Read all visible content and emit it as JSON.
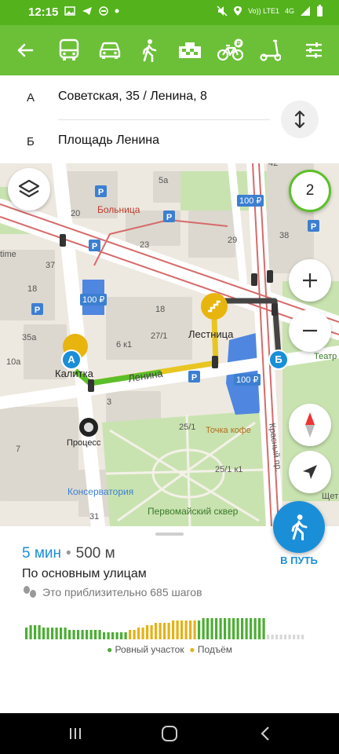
{
  "status_bar": {
    "time": "12:15",
    "network_label": "Vo)) LTE1",
    "network_type": "4G"
  },
  "toolbar": {
    "modes": [
      "back",
      "bus",
      "car",
      "walk",
      "taxi",
      "bike",
      "scooter",
      "settings"
    ]
  },
  "route": {
    "from_letter": "А",
    "from_address": "Советская, 35 / Ленина, 8",
    "to_letter": "Б",
    "to_address": "Площадь Ленина"
  },
  "map": {
    "layers_count": "2",
    "labels": {
      "hospital": "Больница",
      "lenina_street": "Ленина",
      "stairs": "Лестница",
      "kalitka": "Калитка",
      "process": "Процесс",
      "conservatory": "Консерватория",
      "square": "Первомайский сквер",
      "coffee": "Точка кофе",
      "theatre": "Театр",
      "krasny": "Красный пр.",
      "schet": "Щет",
      "time": "time"
    },
    "parking_price": "100 ₽",
    "house_numbers": [
      "5а",
      "20",
      "23",
      "29",
      "37",
      "18",
      "18",
      "35а",
      "10а",
      "27/1",
      "6 к1",
      "3",
      "25/1",
      "25/1 к1",
      "7",
      "31",
      "38",
      "42"
    ],
    "marker_a": "А",
    "marker_b": "Б"
  },
  "summary": {
    "time": "5 мин",
    "distance": "500 м",
    "subtitle": "По основным улицам",
    "steps": "Это приблизительно 685 шагов",
    "legend_flat": "Ровный участок",
    "legend_climb": "Подъём"
  },
  "elevation": {
    "bars": [
      5,
      6,
      6,
      6,
      5,
      5,
      5,
      5,
      5,
      5,
      4,
      4,
      4,
      4,
      4,
      4,
      4,
      4,
      3,
      3,
      3,
      3,
      3,
      3,
      4,
      4,
      5,
      5,
      6,
      6,
      7,
      7,
      7,
      7,
      8,
      8,
      8,
      8,
      8,
      8,
      8,
      9,
      9,
      9,
      9,
      9,
      9,
      9,
      9,
      9,
      9,
      9,
      9,
      9,
      9,
      9,
      2,
      2,
      2,
      2,
      2,
      2,
      2,
      2,
      2
    ],
    "colors": [
      "#4cae34",
      "#e4b218",
      "#d8d8d8"
    ]
  },
  "go": {
    "label": "В ПУТЬ"
  }
}
